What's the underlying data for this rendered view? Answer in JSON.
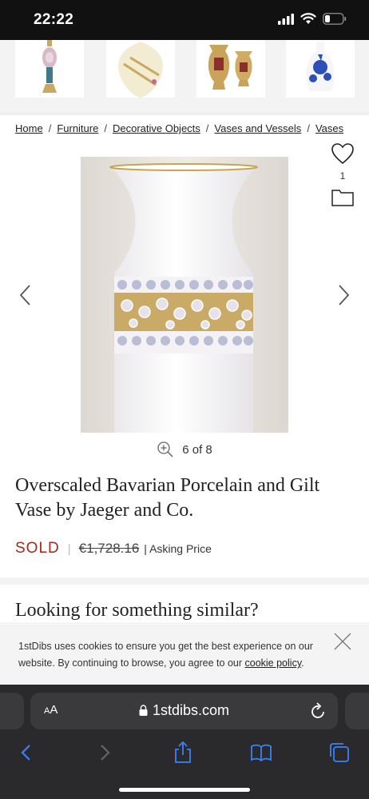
{
  "status_bar": {
    "time": "22:22"
  },
  "thumbnails": [
    {
      "name": "thumb-vase-pink-pedestal"
    },
    {
      "name": "thumb-vase-cream-ribbon"
    },
    {
      "name": "thumb-vase-gold-pair"
    },
    {
      "name": "thumb-vase-blue-white"
    }
  ],
  "breadcrumb": {
    "items": [
      "Home",
      "Furniture",
      "Decorative Objects",
      "Vases and Vessels",
      "Vases"
    ],
    "separator": "/"
  },
  "favorites": {
    "count": "1"
  },
  "gallery": {
    "position_text": "6 of 8"
  },
  "product": {
    "title": "Overscaled Bavarian Porcelain and Gilt Vase by Jaeger and Co.",
    "status": "SOLD",
    "price": "€1,728.16",
    "price_note": "Asking Price"
  },
  "similar_heading": "Looking for something similar?",
  "cookie_banner": {
    "text_before": "1stDibs uses cookies to ensure you get the best experience on our website. By continuing to browse, you agree to our ",
    "link": "cookie policy",
    "text_after": "."
  },
  "browser": {
    "aa_label_small": "A",
    "aa_label_large": "A",
    "url": "1stdibs.com"
  },
  "colors": {
    "sold": "#a12a1c",
    "browser_bg": "#2a2a2c",
    "toolbar_icon": "#3b82f6"
  }
}
